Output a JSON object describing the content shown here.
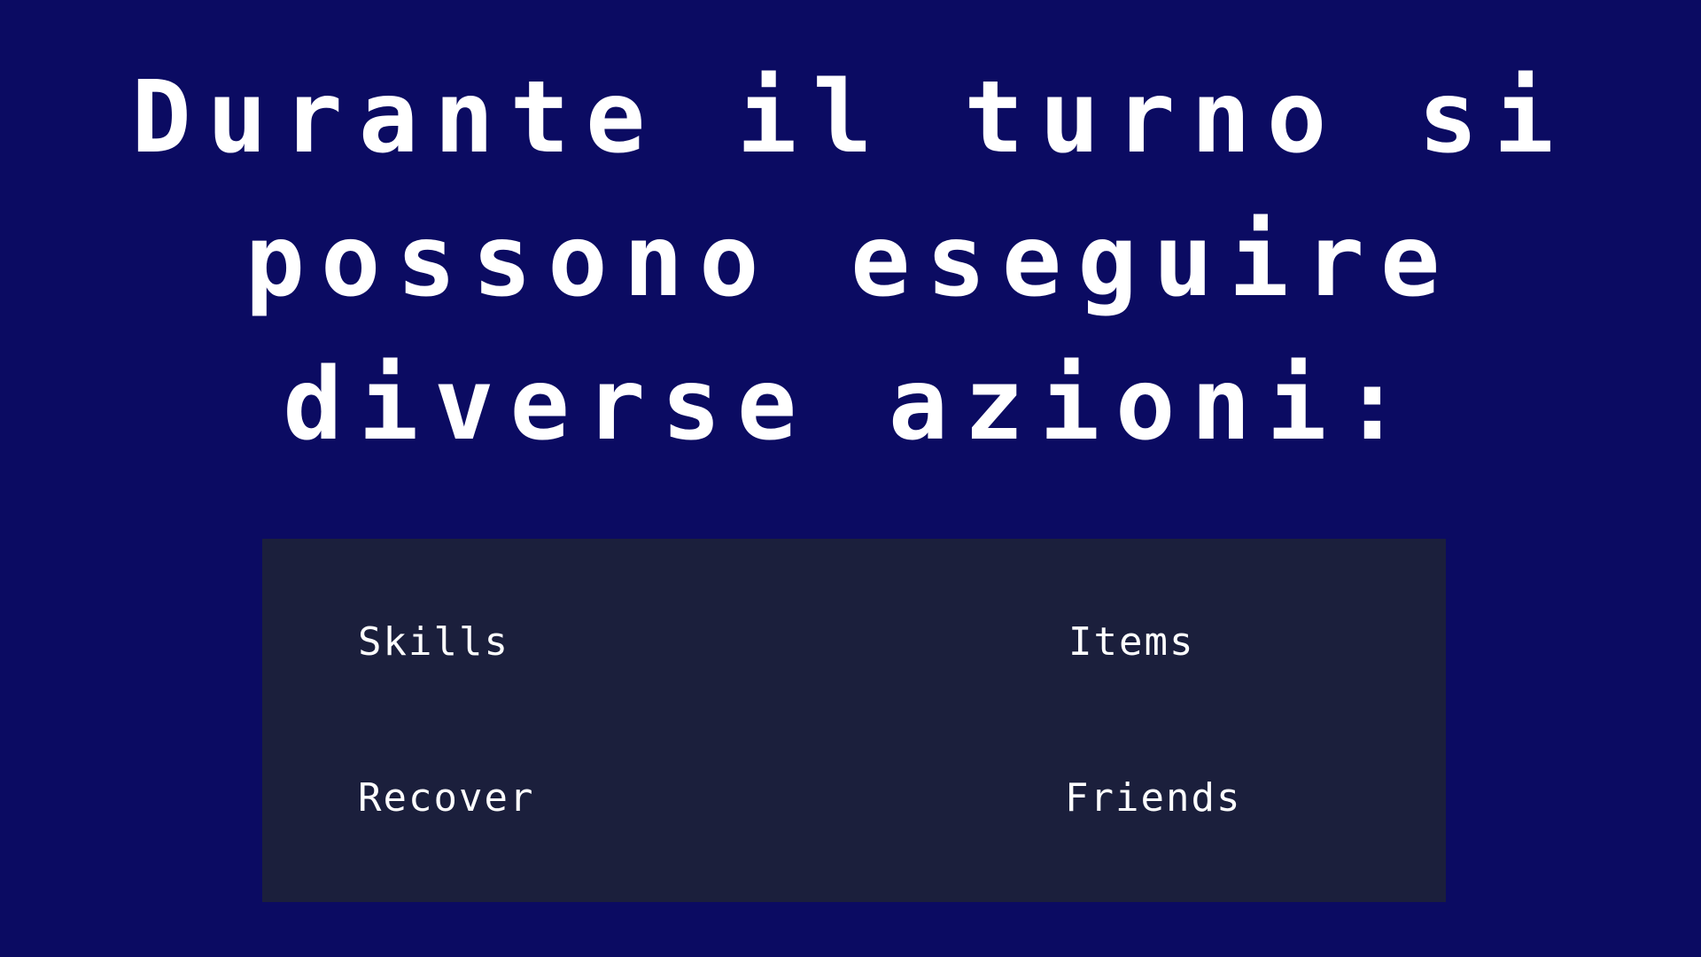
{
  "prompt": {
    "lines": [
      "Durante il turno si",
      "possono eseguire",
      "diverse azioni:"
    ]
  },
  "menu": {
    "items": [
      {
        "label": "Skills"
      },
      {
        "label": "Items"
      },
      {
        "label": "Recover"
      },
      {
        "label": "Friends"
      }
    ]
  },
  "colors": {
    "background": "#0b0b62",
    "menu_panel": "#1b1f3c",
    "text": "#ffffff"
  }
}
